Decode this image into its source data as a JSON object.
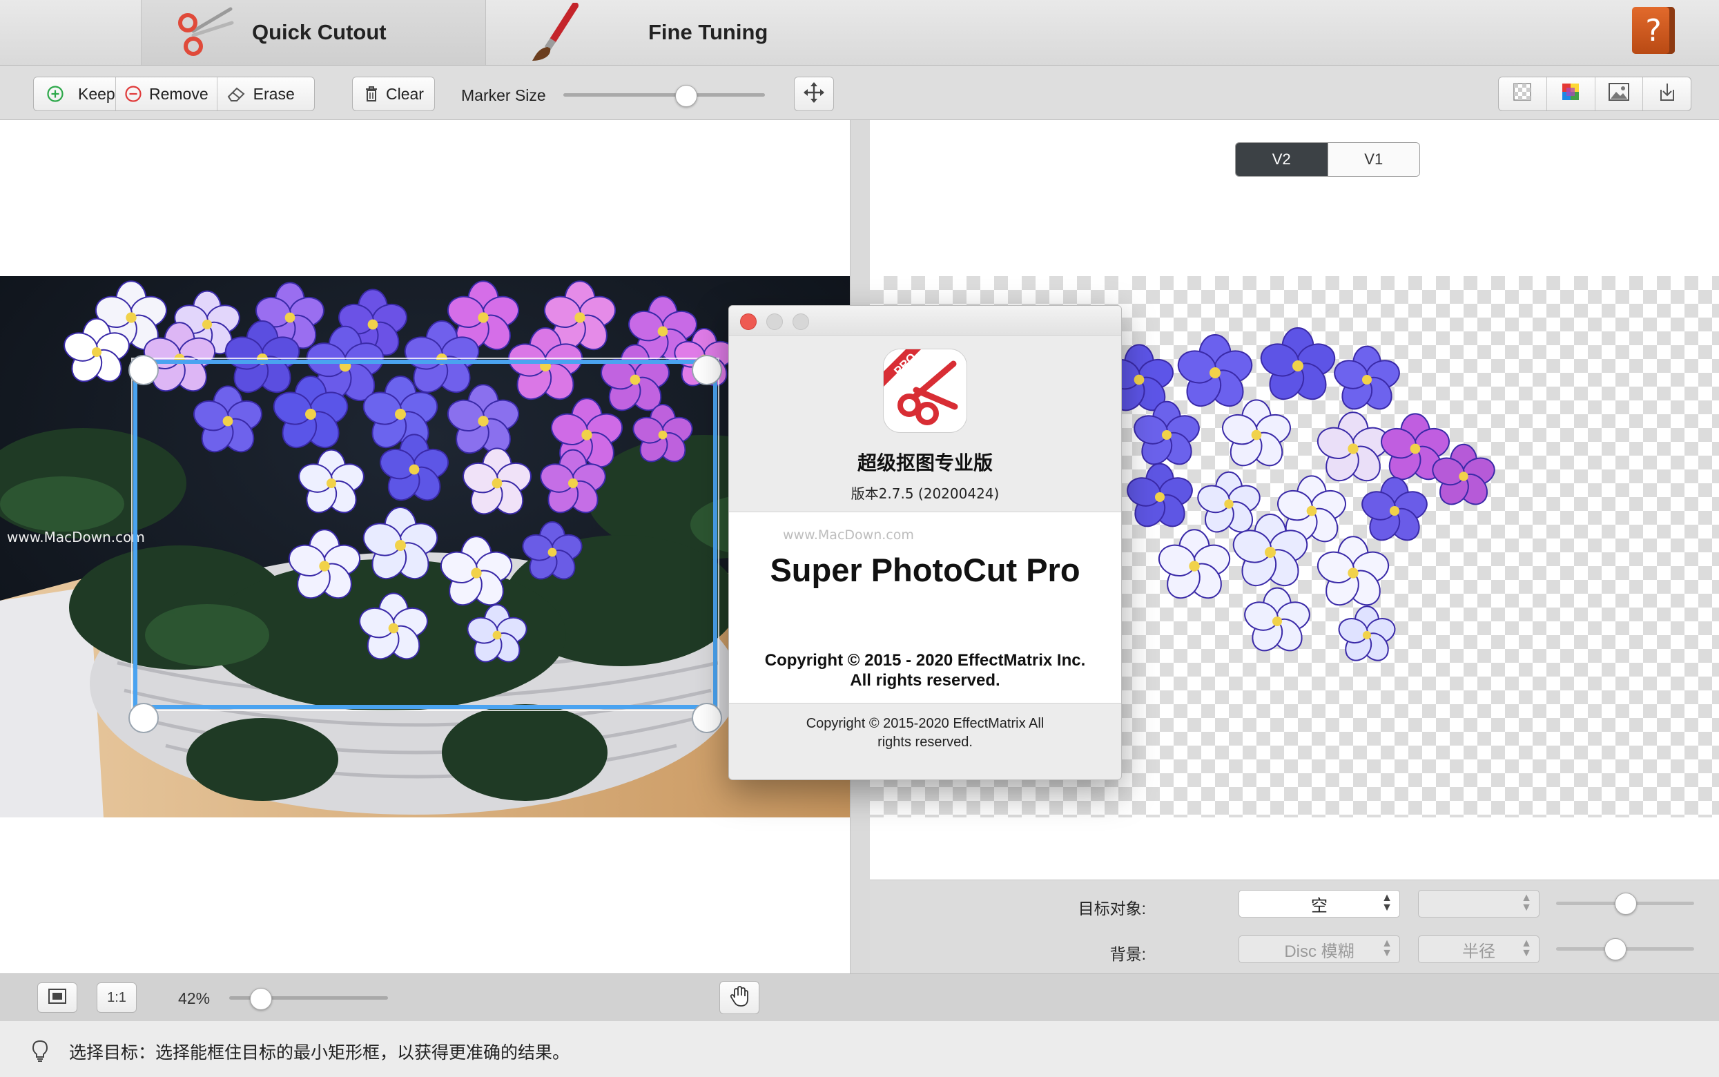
{
  "mode_tabs": {
    "quick": "Quick Cutout",
    "fine": "Fine Tuning"
  },
  "help": {
    "label": "?"
  },
  "toolbar": {
    "keep": "Keep",
    "remove": "Remove",
    "erase": "Erase",
    "clear": "Clear",
    "marker_size_label": "Marker Size",
    "marker_size_value": 0.62
  },
  "version_toggle": {
    "v2": "V2",
    "v1": "V1",
    "selected": "V2"
  },
  "watermark": "www.MacDown.com",
  "about": {
    "app_name": "超级抠图专业版",
    "version": "版本2.7.5 (20200424)",
    "watermark": "www.MacDown.com",
    "product": "Super PhotoCut Pro",
    "copyright_line1": "Copyright © 2015 - 2020 EffectMatrix Inc.",
    "copyright_line2": "All rights reserved.",
    "copyright_footer_line1": "Copyright © 2015-2020 EffectMatrix  All",
    "copyright_footer_line2": "rights reserved.",
    "badge": "PRO"
  },
  "settings": {
    "target_label": "目标对象:",
    "target_value": "空",
    "target_second_value": "",
    "background_label": "背景:",
    "background_value": "Disc 模糊",
    "radius_value": "半径",
    "target_slider": 0.5,
    "background_slider": 0.41
  },
  "zoom": {
    "fit_label": "",
    "actual_label": "1:1",
    "percent": "42%",
    "value": 0.15
  },
  "status": {
    "text": "选择目标：选择能框住目标的最小矩形框，以获得更准确的结果。"
  },
  "colors": {
    "selection": "#4aa3f0",
    "close": "#ee5a52",
    "help": "#d0581f"
  }
}
